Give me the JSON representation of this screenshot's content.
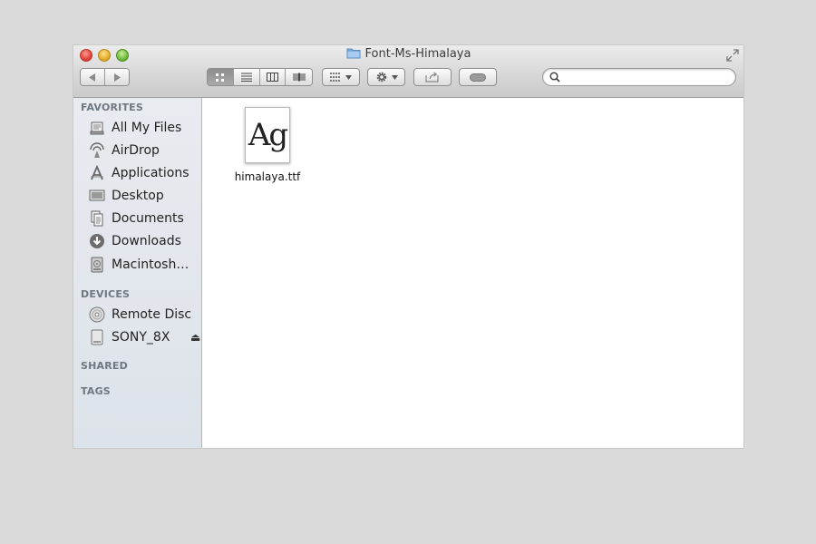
{
  "window": {
    "title": "Font-Ms-Himalaya",
    "controls": [
      "close-button",
      "minimize-button",
      "zoom-button"
    ]
  },
  "toolbar": {
    "nav": [
      "back",
      "forward"
    ],
    "view_modes": [
      "icon-view",
      "list-view",
      "column-view",
      "cover-flow-view"
    ],
    "active_view": "icon-view",
    "arrange_icon": "grid-arrange",
    "action_icon": "gear",
    "share_icon": "share",
    "tags_icon": "tag-toggle",
    "search": {
      "value": "",
      "placeholder": ""
    }
  },
  "sidebar": {
    "sections": [
      {
        "header": "FAVORITES",
        "items": [
          {
            "label": "All My Files",
            "icon": "all-files"
          },
          {
            "label": "AirDrop",
            "icon": "airdrop"
          },
          {
            "label": "Applications",
            "icon": "applications"
          },
          {
            "label": "Desktop",
            "icon": "desktop"
          },
          {
            "label": "Documents",
            "icon": "documents"
          },
          {
            "label": "Downloads",
            "icon": "downloads"
          },
          {
            "label": "Macintosh…",
            "icon": "hard-drive"
          }
        ]
      },
      {
        "header": "DEVICES",
        "items": [
          {
            "label": "Remote Disc",
            "icon": "disc"
          },
          {
            "label": "SONY_8X",
            "icon": "usb-drive"
          }
        ]
      },
      {
        "header": "SHARED",
        "items": []
      },
      {
        "header": "TAGS",
        "items": []
      }
    ],
    "eject_glyph": "⏏"
  },
  "content": {
    "files": [
      {
        "name": "himalaya.ttf",
        "preview": "Ag"
      }
    ]
  },
  "colors": {
    "sidebar_bg": "#e2e7ed",
    "section_header": "#6f7780",
    "desktop_bg": "#dadada"
  }
}
